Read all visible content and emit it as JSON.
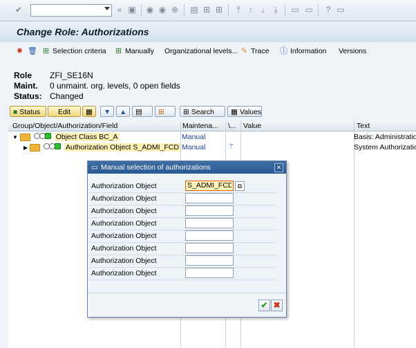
{
  "title": "Change Role: Authorizations",
  "app_toolbar": {
    "selection_criteria": "Selection criteria",
    "manually": "Manually",
    "org_levels": "Organizational levels...",
    "trace": "Trace",
    "information": "Information",
    "versions": "Versions"
  },
  "info": {
    "role_label": "Role",
    "role_value": "ZFI_SE16N",
    "maint_label": "Maint.",
    "maint_value": "0 unmaint. org. levels, 0 open fields",
    "status_label": "Status:",
    "status_value": "Changed"
  },
  "tree_toolbar": {
    "status": "Status",
    "edit": "Edit",
    "search": "Search",
    "values": "Values"
  },
  "tree": {
    "columns": [
      "Group/Object/Authorization/Field",
      "Maintena...",
      "\\...",
      "Value",
      "Text"
    ],
    "rows": [
      {
        "label": "Object Class BC_A",
        "maint": "Manual",
        "text": "Basis: Administration"
      },
      {
        "label": "Authorization Object S_ADMI_FCD",
        "maint": "Manual",
        "text": "System Authorization"
      }
    ]
  },
  "dialog": {
    "title": "Manual selection of authorizations",
    "field_label": "Authorization Object",
    "first_value": "S_ADMI_FCD"
  },
  "colors": {
    "title_bar": "#d4e0ec",
    "dialog_title": "#2a5a91",
    "highlight": "#fdf2b6",
    "traffic_green": "#2ac12a"
  }
}
